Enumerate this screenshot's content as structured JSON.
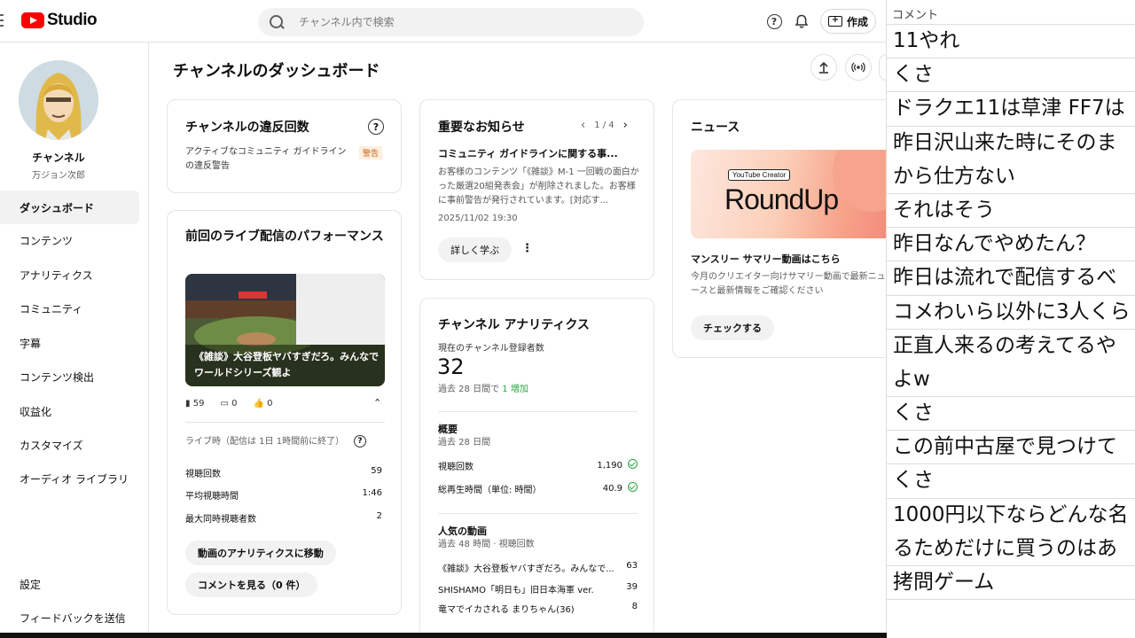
{
  "app": {
    "logo_text": "Studio",
    "search_placeholder": "チャンネル内で検索",
    "create_label": "作成"
  },
  "sidebar": {
    "channel_name": "チャンネル",
    "channel_handle": "万ジョン次郎",
    "items": [
      {
        "label": "ダッシュボード",
        "active": true
      },
      {
        "label": "コンテンツ"
      },
      {
        "label": "アナリティクス"
      },
      {
        "label": "コミュニティ"
      },
      {
        "label": "字幕"
      },
      {
        "label": "コンテンツ検出"
      },
      {
        "label": "収益化"
      },
      {
        "label": "カスタマイズ"
      },
      {
        "label": "オーディオ ライブラリ"
      }
    ],
    "bottom_items": [
      {
        "label": "設定"
      },
      {
        "label": "フィードバックを送信"
      }
    ]
  },
  "main": {
    "title": "チャンネルのダッシュボード",
    "violations": {
      "title": "チャンネルの違反回数",
      "text": "アクティブなコミュニティ ガイドラインの違反警告",
      "badge": "警告"
    },
    "live": {
      "title": "前回のライブ配信のパフォーマンス",
      "thumb_title": "《雑談》大谷登板ヤバすぎだろ。みんなでワールドシリーズ観よ",
      "views": "59",
      "comments": "0",
      "likes": "0",
      "live_time": "ライブ時（配信は 1日 1時間前に終了）",
      "stats": [
        {
          "label": "視聴回数",
          "value": "59"
        },
        {
          "label": "平均視聴時間",
          "value": "1:46"
        },
        {
          "label": "最大同時視聴者数",
          "value": "2"
        }
      ],
      "analytics_btn": "動画のアナリティクスに移動",
      "comments_btn": "コメントを見る（0 件）"
    },
    "notice": {
      "title": "重要なお知らせ",
      "pager": "1 / 4",
      "headline": "コミュニティ ガイドラインに関する事...",
      "body": "お客様のコンテンツ「《雑談》M-1 一回戦の面白かった厳選20組発表会」が削除されました。お客様に事前警告が発行されています。[対応す...",
      "date": "2025/11/02 19:30",
      "learn_btn": "詳しく学ぶ"
    },
    "analytics": {
      "title": "チャンネル アナリティクス",
      "subs_label": "現在のチャンネル登録者数",
      "subs_value": "32",
      "subs_change_prefix": "過去 28 日間で",
      "subs_change": "1 増加",
      "summary_title": "概要",
      "summary_period": "過去 28 日間",
      "summary": [
        {
          "label": "視聴回数",
          "value": "1,190"
        },
        {
          "label": "総再生時間（単位: 時間）",
          "value": "40.9"
        }
      ],
      "popular_title": "人気の動画",
      "popular_period": "過去 48 時間 · 視聴回数",
      "popular": [
        {
          "label": "《雑談》大谷登板ヤバすぎだろ。みんなで...",
          "value": "63"
        },
        {
          "label": "SHISHAMO「明日も」旧日本海軍 ver.",
          "value": "39"
        },
        {
          "label": "竜マでイカされる まりちゃん(36)",
          "value": "8"
        }
      ]
    },
    "news": {
      "title": "ニュース",
      "banner_tag": "YouTube Creator",
      "banner_title": "RoundUp",
      "headline": "マンスリー サマリー動画はこちら",
      "body": "今月のクリエイター向けサマリー動画で最新ニュースと最新情報をご確認ください",
      "check_btn": "チェックする"
    }
  },
  "comments_panel": {
    "header": "コメント",
    "items": [
      "11やれ",
      "くさ",
      "ドラクエ11は草津 FF7は",
      "昨日沢山来た時にそのま",
      "から仕方ない",
      "それはそう",
      "昨日なんでやめたん？",
      "昨日は流れで配信するべ",
      "コメわいら以外に3人くら",
      "正直人来るの考えてるや",
      "よw",
      "くさ",
      "この前中古屋で見つけて",
      "くさ",
      "1000円以下ならどんな名",
      "るためだけに買うのはあ",
      "拷問ゲーム"
    ]
  }
}
